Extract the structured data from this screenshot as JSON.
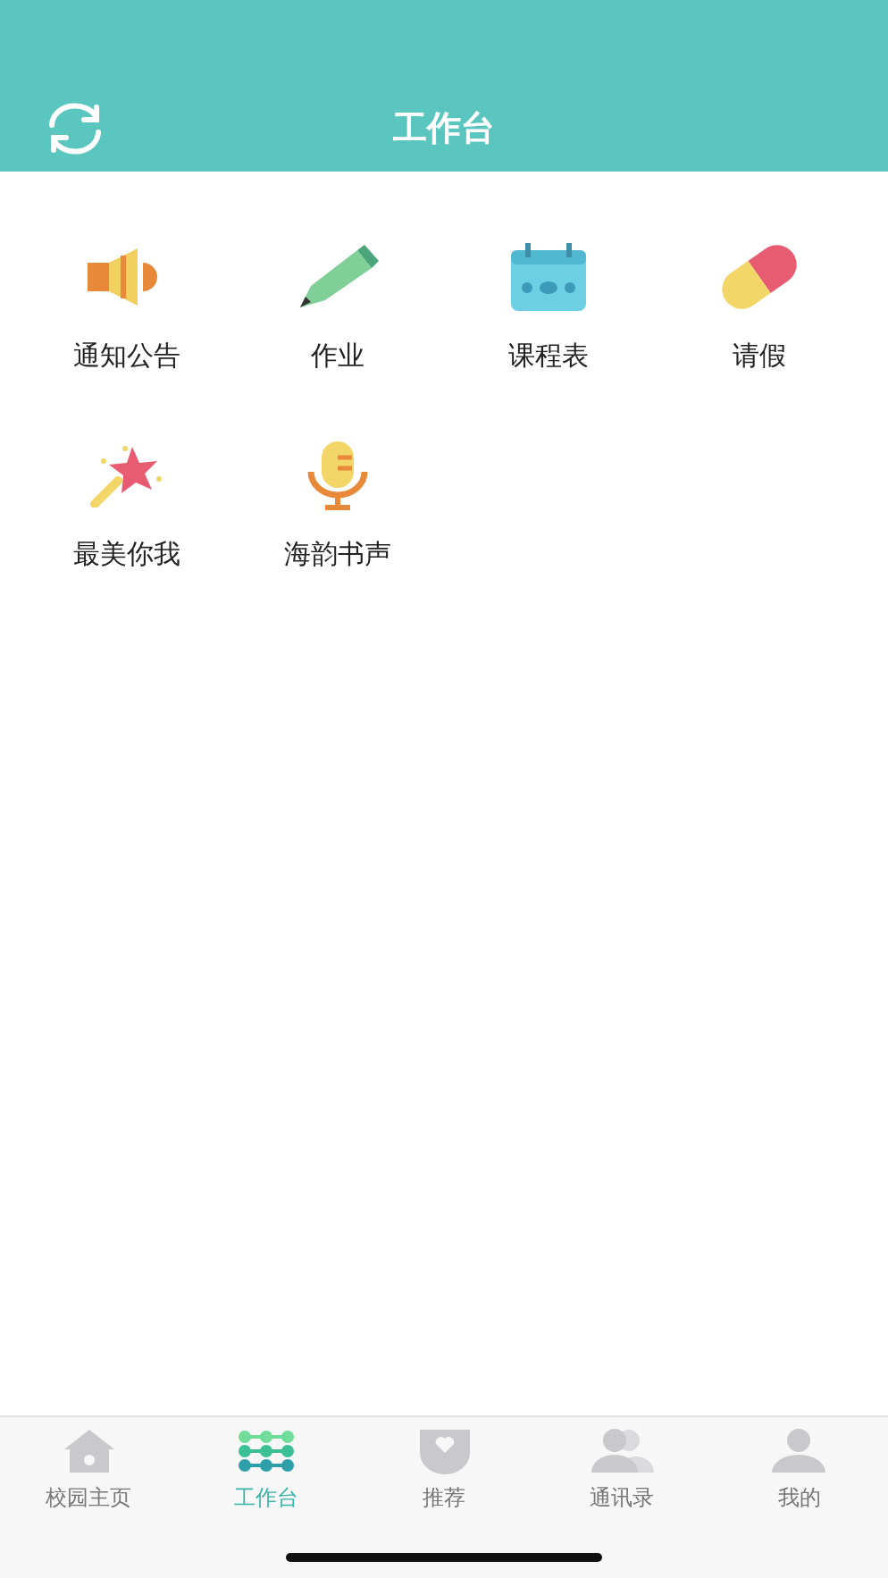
{
  "header": {
    "title": "工作台"
  },
  "apps": [
    {
      "label": "通知公告"
    },
    {
      "label": "作业"
    },
    {
      "label": "课程表"
    },
    {
      "label": "请假"
    },
    {
      "label": "最美你我"
    },
    {
      "label": "海韵书声"
    }
  ],
  "tab_bar": [
    {
      "label": "校园主页",
      "selected": false
    },
    {
      "label": "工作台",
      "selected": true
    },
    {
      "label": "推荐",
      "selected": false
    },
    {
      "label": "通讯录",
      "selected": false
    },
    {
      "label": "我的",
      "selected": false
    }
  ]
}
